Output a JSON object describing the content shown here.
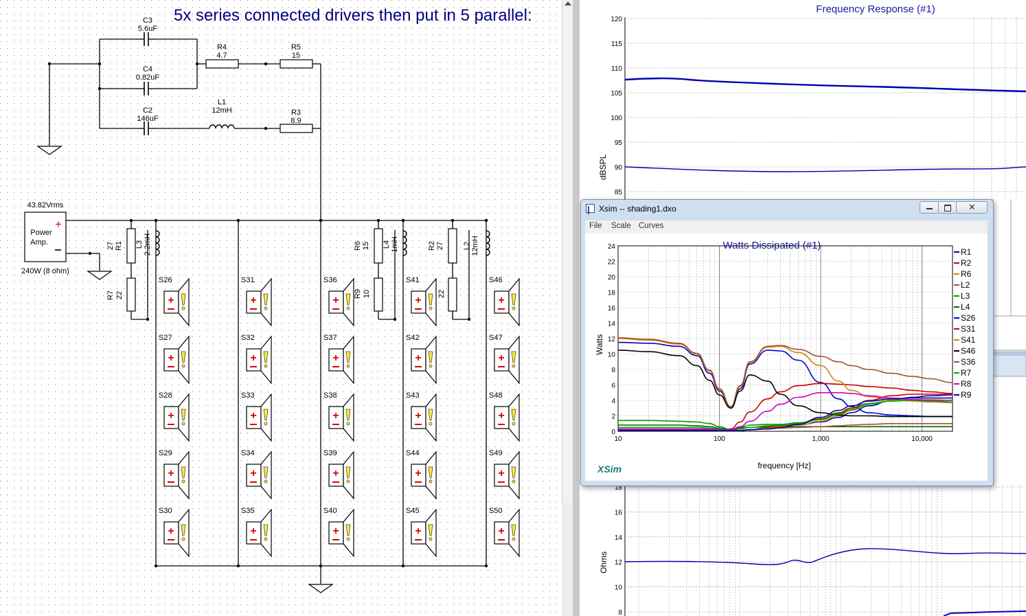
{
  "schematic": {
    "heading": "5x series connected drivers then put in 5 parallel:",
    "amp": {
      "voltage": "43.82Vrms",
      "line1": "Power",
      "line2": "Amp.",
      "rating": "240W (8 ohm)"
    },
    "components": [
      {
        "name": "C3",
        "value": "5.6uF"
      },
      {
        "name": "C4",
        "value": "0.82uF"
      },
      {
        "name": "C2",
        "value": "146uF"
      },
      {
        "name": "R4",
        "value": "4.7"
      },
      {
        "name": "R5",
        "value": "15"
      },
      {
        "name": "L1",
        "value": "12mH"
      },
      {
        "name": "R3",
        "value": "8.9"
      },
      {
        "name": "R1",
        "value": "27"
      },
      {
        "name": "L3",
        "value": "2.2mH"
      },
      {
        "name": "R7",
        "value": "22"
      },
      {
        "name": "R6",
        "value": "15"
      },
      {
        "name": "L4",
        "value": "1mH"
      },
      {
        "name": "R9",
        "value": "10"
      },
      {
        "name": "R2",
        "value": "27"
      },
      {
        "name": "L2",
        "value": "12mH"
      },
      {
        "name": "R8",
        "value": "22"
      }
    ],
    "speaker_columns": [
      [
        "S26",
        "S27",
        "S28",
        "S29",
        "S30"
      ],
      [
        "S31",
        "S32",
        "S33",
        "S34",
        "S35"
      ],
      [
        "S36",
        "S37",
        "S38",
        "S39",
        "S40"
      ],
      [
        "S41",
        "S42",
        "S43",
        "S44",
        "S45"
      ],
      [
        "S46",
        "S47",
        "S48",
        "S49",
        "S50"
      ]
    ]
  },
  "freq_window": {
    "title": "Frequency Response (#1)",
    "ylabel": "dBSPL",
    "yticks": [
      "120",
      "115",
      "110",
      "105",
      "100",
      "95",
      "90",
      "85"
    ]
  },
  "imp_window": {
    "ylabel": "Ohms",
    "yticks": [
      "18",
      "16",
      "14",
      "12",
      "10",
      "8"
    ]
  },
  "xsim_window": {
    "title": "Xsim -- shading1.dxo",
    "menu": [
      "File",
      "Scale",
      "Curves"
    ],
    "brand": "XSim"
  },
  "chart_data": {
    "type": "line",
    "title": "Watts Dissipated (#1)",
    "xlabel": "frequency [Hz]",
    "ylabel": "Watts",
    "x_scale": "log",
    "xlim": [
      10,
      20000
    ],
    "ylim": [
      0,
      24
    ],
    "x_ticks": [
      "10",
      "100",
      "1,000",
      "10,000"
    ],
    "y_ticks": [
      "0",
      "2",
      "4",
      "6",
      "8",
      "10",
      "12",
      "14",
      "16",
      "18",
      "20",
      "22",
      "24"
    ],
    "grid": true,
    "legend_position": "right",
    "x": [
      10,
      20,
      40,
      60,
      80,
      100,
      130,
      160,
      200,
      300,
      400,
      600,
      1000,
      1500,
      2000,
      3000,
      5000,
      8000,
      12000,
      20000
    ],
    "series": [
      {
        "name": "R1",
        "color": "#0000cc",
        "values": [
          11.5,
          11.4,
          11.0,
          9.8,
          7.5,
          5.2,
          3.0,
          5.5,
          8.7,
          10.5,
          10.4,
          9.2,
          6.3,
          4.2,
          3.2,
          2.4,
          2.1,
          2.0,
          1.9,
          1.9
        ]
      },
      {
        "name": "R2",
        "color": "#cc0000",
        "values": [
          0.2,
          0.2,
          0.2,
          0.2,
          0.15,
          0.1,
          0.3,
          1.2,
          2.5,
          4.2,
          5.1,
          5.9,
          6.2,
          6.1,
          6.0,
          5.8,
          5.6,
          5.3,
          5.1,
          4.9
        ]
      },
      {
        "name": "R6",
        "color": "#cc8800",
        "values": [
          12.0,
          11.8,
          11.3,
          10.0,
          7.8,
          5.4,
          3.1,
          5.8,
          8.9,
          10.9,
          11.0,
          10.2,
          8.5,
          6.5,
          5.3,
          4.5,
          4.1,
          3.9,
          3.8,
          3.7
        ]
      },
      {
        "name": "L2",
        "color": "#a0522d",
        "values": [
          12.1,
          11.9,
          11.4,
          10.1,
          7.9,
          5.5,
          3.2,
          5.9,
          9.0,
          11.0,
          11.1,
          10.6,
          9.7,
          9.0,
          8.5,
          8.0,
          7.5,
          7.1,
          6.8,
          6.3
        ]
      },
      {
        "name": "L3",
        "color": "#009900",
        "values": [
          1.4,
          1.4,
          1.3,
          1.2,
          1.0,
          0.6,
          0.2,
          0.5,
          0.8,
          0.9,
          0.9,
          1.1,
          1.6,
          2.4,
          3.0,
          3.6,
          4.0,
          4.1,
          4.0,
          3.8
        ]
      },
      {
        "name": "L4",
        "color": "#006600",
        "values": [
          0.8,
          0.8,
          0.8,
          0.7,
          0.6,
          0.4,
          0.2,
          0.4,
          0.5,
          0.6,
          0.6,
          0.6,
          0.6,
          0.6,
          0.6,
          0.6,
          0.6,
          0.6,
          0.6,
          0.6
        ]
      },
      {
        "name": "S26",
        "color": "#0000cc",
        "values": [
          0.2,
          0.2,
          0.2,
          0.2,
          0.2,
          0.1,
          0.1,
          0.1,
          0.2,
          0.4,
          0.6,
          0.8,
          1.2,
          1.8,
          2.4,
          3.3,
          4.0,
          4.4,
          4.6,
          4.7
        ]
      },
      {
        "name": "S31",
        "color": "#cc0000",
        "values": [
          0.2,
          0.2,
          0.2,
          0.2,
          0.2,
          0.1,
          0.1,
          0.1,
          0.2,
          0.5,
          0.7,
          1.0,
          1.6,
          2.3,
          3.0,
          4.0,
          4.6,
          4.8,
          4.8,
          4.8
        ]
      },
      {
        "name": "S41",
        "color": "#cc8800",
        "values": [
          0.2,
          0.2,
          0.2,
          0.2,
          0.2,
          0.1,
          0.1,
          0.1,
          0.2,
          0.4,
          0.6,
          0.8,
          1.3,
          2.0,
          2.7,
          3.5,
          4.0,
          4.1,
          4.1,
          4.0
        ]
      },
      {
        "name": "S46",
        "color": "#000000",
        "values": [
          10.5,
          10.3,
          9.8,
          8.5,
          6.6,
          4.7,
          3.0,
          5.2,
          7.3,
          6.5,
          4.8,
          3.3,
          2.4,
          2.1,
          2.0,
          2.0,
          1.9,
          1.9,
          1.9,
          1.9
        ]
      },
      {
        "name": "S36",
        "color": "#a0522d",
        "values": [
          0.2,
          0.2,
          0.2,
          0.2,
          0.2,
          0.1,
          0.1,
          0.1,
          0.2,
          0.3,
          0.4,
          0.5,
          0.6,
          0.7,
          0.8,
          0.9,
          1.0,
          1.0,
          1.0,
          1.0
        ]
      },
      {
        "name": "R7",
        "color": "#00aa00",
        "values": [
          0.5,
          0.5,
          0.5,
          0.5,
          0.4,
          0.3,
          0.1,
          0.3,
          0.5,
          0.7,
          0.8,
          1.0,
          1.5,
          2.2,
          2.8,
          3.5,
          3.9,
          4.0,
          3.9,
          3.8
        ]
      },
      {
        "name": "R8",
        "color": "#cc00cc",
        "values": [
          0.3,
          0.3,
          0.3,
          0.3,
          0.3,
          0.2,
          0.2,
          0.6,
          1.3,
          2.6,
          3.5,
          4.4,
          5.0,
          5.0,
          4.9,
          4.6,
          4.3,
          4.1,
          4.0,
          4.0
        ]
      },
      {
        "name": "R9",
        "color": "#0000aa",
        "values": [
          0.1,
          0.1,
          0.1,
          0.1,
          0.1,
          0.1,
          0.1,
          0.1,
          0.2,
          0.3,
          0.5,
          0.9,
          1.8,
          2.7,
          3.3,
          3.9,
          4.2,
          4.3,
          4.3,
          4.3
        ]
      }
    ]
  }
}
